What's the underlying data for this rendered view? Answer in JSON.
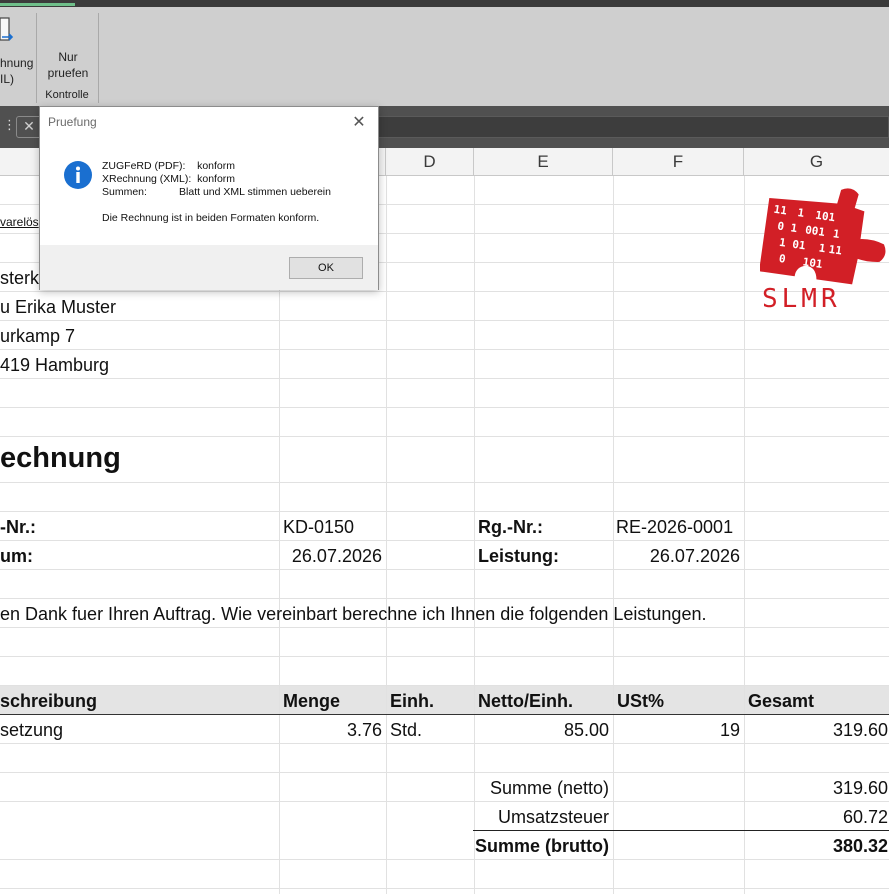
{
  "ribbon": {
    "xml_button_line1": "hnung",
    "xml_button_line2": "IL)",
    "nur_pruefen_line1": "Nur",
    "nur_pruefen_line2": "pruefen",
    "group_label": "Kontrolle"
  },
  "formula_bar": {
    "menu_glyph": "⋮",
    "cancel_glyph": "✕"
  },
  "columns": [
    "D",
    "E",
    "F",
    "G"
  ],
  "sheet": {
    "row_a1": "varelös",
    "sender_line1": "sterku",
    "sender_line2": "u Erika Muster",
    "sender_line3": "urkamp 7",
    "sender_line4": "419 Hamburg",
    "title": "echnung",
    "kd_label": "-Nr.:",
    "kd_value": "KD-0150",
    "rg_label": "Rg.-Nr.:",
    "rg_value": "RE-2026-0001",
    "datum_label": "um:",
    "datum_value": "26.07.2026",
    "leistung_label": "Leistung:",
    "leistung_value": "26.07.2026",
    "intro_text": "en Dank fuer Ihren Auftrag. Wie vereinbart berechne ich Ihnen die folgenden Leistungen.",
    "table_headers": {
      "beschreibung": "schreibung",
      "menge": "Menge",
      "einh": "Einh.",
      "netto": "Netto/Einh.",
      "ust": "USt%",
      "gesamt": "Gesamt"
    },
    "items": [
      {
        "beschreibung": "setzung",
        "menge": "3.76",
        "einh": "Std.",
        "netto": "85.00",
        "ust": "19",
        "gesamt": "319.60"
      }
    ],
    "summary": {
      "netto_label": "Summe (netto)",
      "netto_value": "319.60",
      "ust_label": "Umsatzsteuer",
      "ust_value": "60.72",
      "brutto_label": "Summe (brutto)",
      "brutto_value": "380.32"
    },
    "logo_text": "SLMR"
  },
  "dialog": {
    "title": "Pruefung",
    "close_glyph": "✕",
    "line1": "ZUGFeRD (PDF):    konform",
    "line2": "XRechnung (XML):  konform",
    "line3": "Summen:           Blatt und XML stimmen ueberein",
    "message": "Die Rechnung ist in beiden Formaten konform.",
    "ok_label": "OK"
  },
  "colors": {
    "logo_red": "#d21f26",
    "info_blue": "#1a6fd0"
  }
}
